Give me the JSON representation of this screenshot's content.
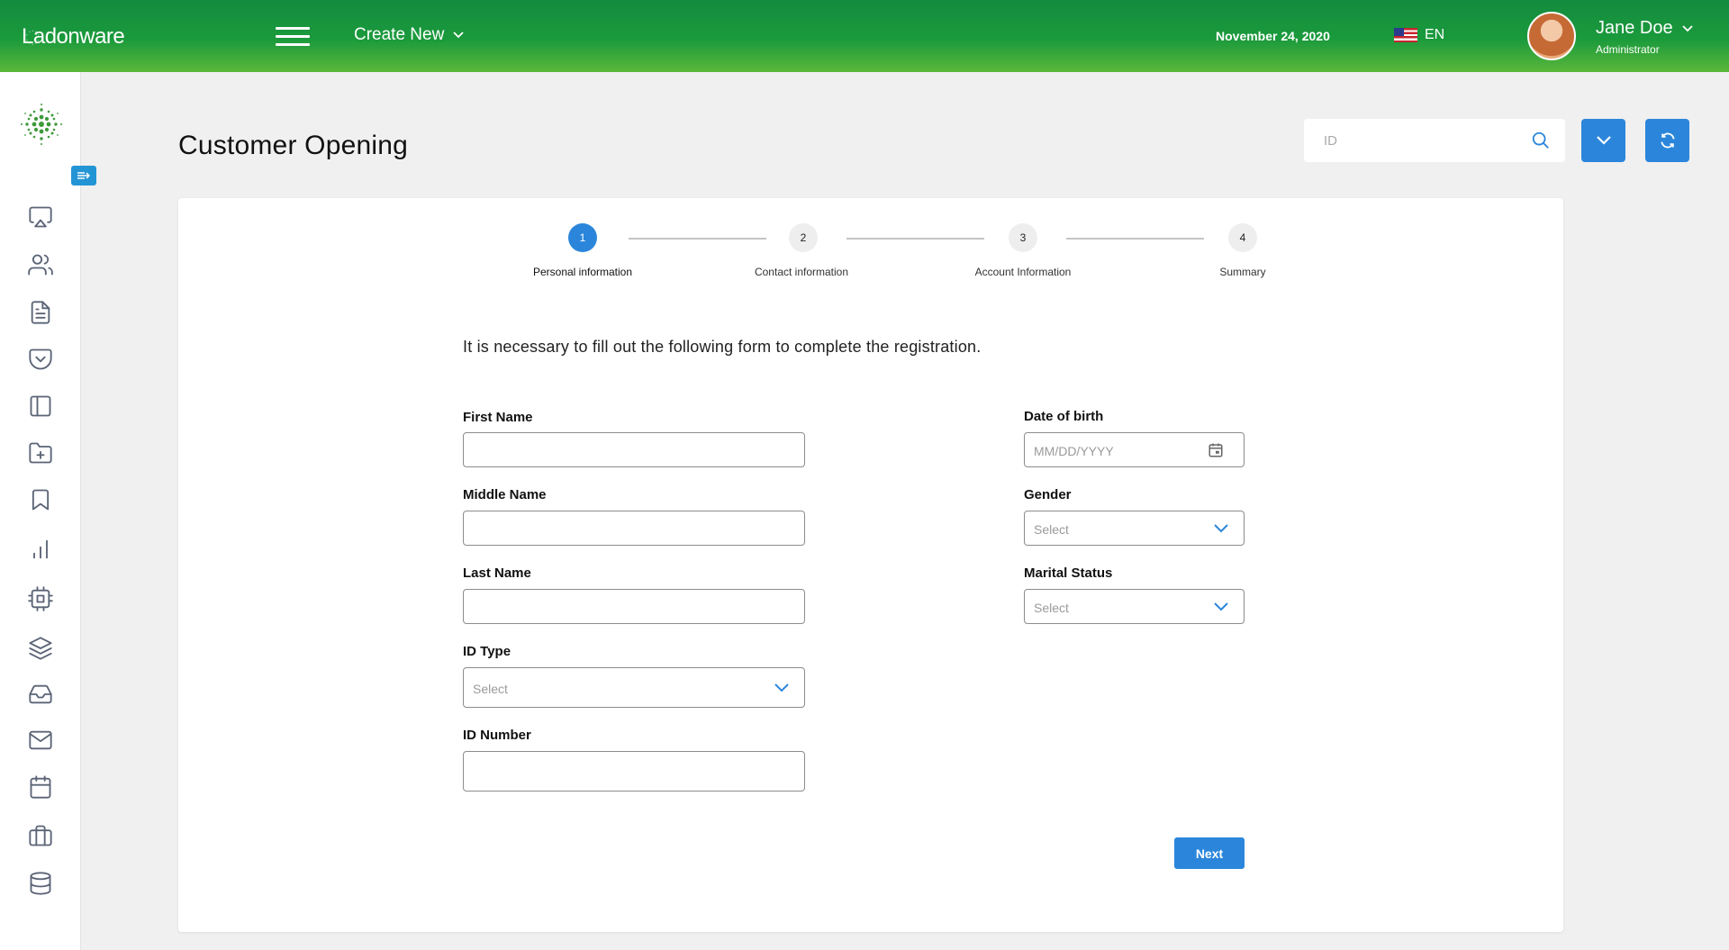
{
  "header": {
    "logo_text": "Ladonware",
    "create_new_label": "Create New",
    "date": "November 24, 2020",
    "language": "EN",
    "user_name": "Jane Doe",
    "user_role": "Administrator"
  },
  "colors": {
    "topbar_green": "#1b9a3c",
    "accent_blue": "#2b86db",
    "sidebar_icon": "#5b6476"
  },
  "sidebar": {
    "items": [
      {
        "icon": "airplay-icon"
      },
      {
        "icon": "users-icon"
      },
      {
        "icon": "document-icon"
      },
      {
        "icon": "pocket-icon"
      },
      {
        "icon": "sidebar-layout-icon"
      },
      {
        "icon": "folder-plus-icon"
      },
      {
        "icon": "bookmark-icon"
      },
      {
        "icon": "bar-chart-icon"
      },
      {
        "icon": "cpu-icon"
      },
      {
        "icon": "layers-icon"
      },
      {
        "icon": "inbox-icon"
      },
      {
        "icon": "mail-icon"
      },
      {
        "icon": "calendar-icon"
      },
      {
        "icon": "briefcase-icon"
      },
      {
        "icon": "database-icon"
      }
    ]
  },
  "page": {
    "title": "Customer Opening",
    "search_placeholder": "ID"
  },
  "stepper": {
    "steps": [
      {
        "number": "1",
        "label": "Personal information",
        "active": true
      },
      {
        "number": "2",
        "label": "Contact information",
        "active": false
      },
      {
        "number": "3",
        "label": "Account Information",
        "active": false
      },
      {
        "number": "4",
        "label": "Summary",
        "active": false
      }
    ]
  },
  "form": {
    "intro": "It is necessary to fill out the following form to complete the registration.",
    "first_name": {
      "label": "First Name",
      "value": ""
    },
    "middle_name": {
      "label": "Middle Name",
      "value": ""
    },
    "last_name": {
      "label": "Last Name",
      "value": ""
    },
    "id_type": {
      "label": "ID Type",
      "selected": "Select"
    },
    "id_number": {
      "label": "ID Number",
      "value": ""
    },
    "date_of_birth": {
      "label": "Date of birth",
      "placeholder": "MM/DD/YYYY"
    },
    "gender": {
      "label": "Gender",
      "selected": "Select"
    },
    "marital_status": {
      "label": "Marital Status",
      "selected": "Select"
    },
    "next_label": "Next"
  }
}
